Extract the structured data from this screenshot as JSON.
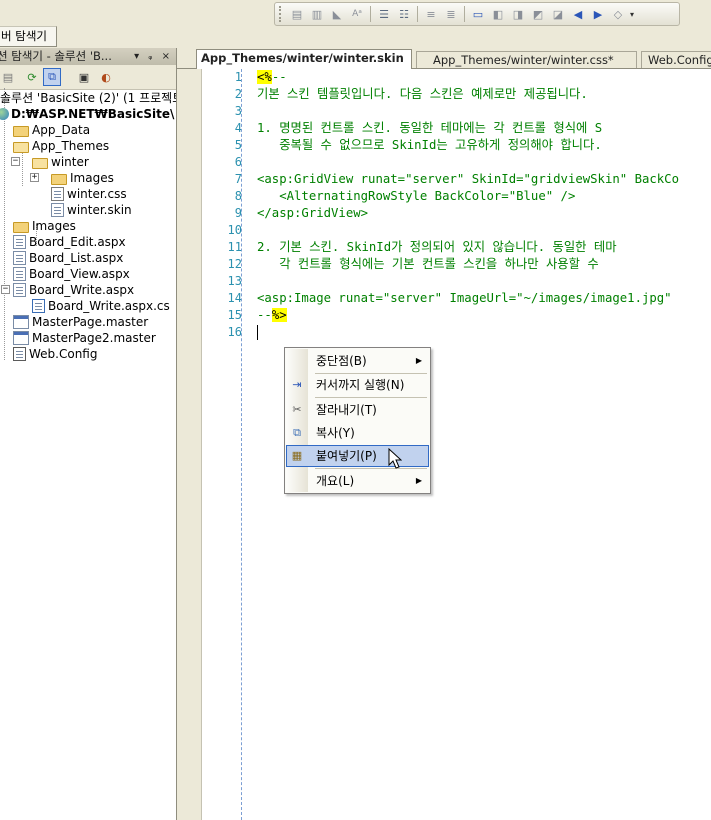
{
  "top": {
    "server_tab": "버 탐색기"
  },
  "toolbar": {
    "icons": [
      "format-icon",
      "indent-icon",
      "outdent-icon",
      "font-icon",
      "decrease-indent-icon",
      "increase-indent-icon",
      "comment-icon",
      "uncomment-icon",
      "bookmark-icon",
      "prev-bookmark-icon",
      "next-bookmark-icon",
      "prev-bookmark-folder-icon",
      "next-bookmark-folder-icon",
      "clear-bookmarks-icon",
      "toolbar-options-icon"
    ]
  },
  "solution_explorer": {
    "title": "션 탐색기 - 솔루션 'B...",
    "title_controls": "▾ ᵩ ×",
    "solution_label": "솔루션 'BasicSite (2)' (1 프로젝트)",
    "project_label": "D:₩ASP.NET₩BasicSite\\",
    "items": [
      {
        "label": "App_Data"
      },
      {
        "label": "App_Themes"
      },
      {
        "label": "winter"
      },
      {
        "label": "Images"
      },
      {
        "label": "winter.css"
      },
      {
        "label": "winter.skin"
      },
      {
        "label": "Images"
      },
      {
        "label": "Board_Edit.aspx"
      },
      {
        "label": "Board_List.aspx"
      },
      {
        "label": "Board_View.aspx"
      },
      {
        "label": "Board_Write.aspx"
      },
      {
        "label": "Board_Write.aspx.cs"
      },
      {
        "label": "MasterPage.master"
      },
      {
        "label": "MasterPage2.master"
      },
      {
        "label": "Web.Config"
      }
    ]
  },
  "editor": {
    "tabs": [
      {
        "label": "App_Themes/winter/winter.skin"
      },
      {
        "label": "App_Themes/winter/winter.css*"
      },
      {
        "label": "Web.Config"
      }
    ],
    "line_numbers": [
      "1",
      "2",
      "3",
      "4",
      "5",
      "6",
      "7",
      "8",
      "9",
      "10",
      "11",
      "12",
      "13",
      "14",
      "15",
      "16"
    ],
    "lines": {
      "l1_delim": "<%",
      "l1_rest": "--",
      "l2": "기본 스킨 템플릿입니다. 다음 스킨은 예제로만 제공됩니다.",
      "l4": "1. 명명된 컨트롤 스킨. 동일한 테마에는 각 컨트롤 형식에 S",
      "l5": "   중복될 수 없으므로 SkinId는 고유하게 정의해야 합니다.",
      "l7": "<asp:GridView runat=\"server\" SkinId=\"gridviewSkin\" BackCo",
      "l8": "   <AlternatingRowStyle BackColor=\"Blue\" />",
      "l9": "</asp:GridView>",
      "l11": "2. 기본 스킨. SkinId가 정의되어 있지 않습니다. 동일한 테마",
      "l12": "   각 컨트롤 형식에는 기본 컨트롤 스킨을 하나만 사용할 수",
      "l14": "<asp:Image runat=\"server\" ImageUrl=\"~/images/image1.jpg\"",
      "l15_rest": "--",
      "l15_delim": "%>"
    }
  },
  "context_menu": {
    "items": [
      {
        "label": "중단점(B)",
        "icon": "",
        "submenu": true
      },
      {
        "label": "커서까지 실행(N)",
        "icon": "run-to-cursor-icon"
      },
      {
        "label": "잘라내기(T)",
        "icon": "scissors-icon"
      },
      {
        "label": "복사(Y)",
        "icon": "copy-icon"
      },
      {
        "label": "붙여넣기(P)",
        "icon": "paste-icon",
        "highlighted": true
      },
      {
        "label": "개요(L)",
        "icon": "",
        "submenu": true
      }
    ]
  },
  "colors": {
    "chrome": "#ece9d8",
    "menu_highlight": "#c1d2ee",
    "menu_highlight_border": "#316ac5",
    "code_green": "#008000",
    "line_number": "#2b91af",
    "delimiter_highlight": "#ffff00"
  }
}
